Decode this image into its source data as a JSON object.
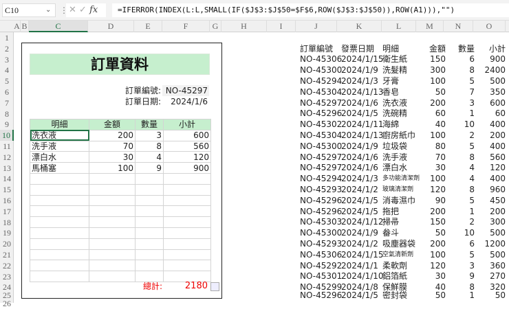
{
  "formula_bar": {
    "name_box": "C10",
    "fx": "fx",
    "formula": "=IFERROR(INDEX(L:L,SMALL(IF($J$3:$J$50=$F$6,ROW($J$3:$J$50)),ROW(A1))),\"\")"
  },
  "columns": [
    "A",
    "B",
    "C",
    "D",
    "E",
    "F",
    "G",
    "H",
    "I",
    "J",
    "K",
    "L",
    "M",
    "N",
    "O"
  ],
  "rows": [
    "1",
    "2",
    "3",
    "4",
    "5",
    "6",
    "7",
    "8",
    "9",
    "10",
    "11",
    "12",
    "13",
    "14",
    "15",
    "16",
    "17",
    "18",
    "19",
    "20",
    "21",
    "22",
    "23",
    "24",
    "25",
    "26"
  ],
  "form": {
    "title": "訂單資料",
    "order_no_label": "訂單編號:",
    "order_no": "NO-45297",
    "order_date_label": "訂單日期:",
    "order_date": "2024/1/6",
    "headers": [
      "明細",
      "金額",
      "數量",
      "小計"
    ],
    "items": [
      [
        "洗衣液",
        "200",
        "3",
        "600"
      ],
      [
        "洗手液",
        "70",
        "8",
        "560"
      ],
      [
        "漂白水",
        "30",
        "4",
        "120"
      ],
      [
        "馬桶塞",
        "100",
        "9",
        "900"
      ]
    ],
    "empty_rows": 10,
    "total_label": "總計:",
    "total": "2180"
  },
  "source": {
    "headers": [
      "訂單編號",
      "發票日期",
      "明細",
      "金額",
      "數量",
      "小計"
    ],
    "rows": [
      [
        "NO-45306",
        "2024/1/15",
        "衛生紙",
        "150",
        "6",
        "900"
      ],
      [
        "NO-45300",
        "2024/1/9",
        "洗髮精",
        "300",
        "8",
        "2400"
      ],
      [
        "NO-45294",
        "2024/1/3",
        "牙膏",
        "100",
        "5",
        "500"
      ],
      [
        "NO-45304",
        "2024/1/13",
        "香皂",
        "50",
        "7",
        "350"
      ],
      [
        "NO-45297",
        "2024/1/6",
        "洗衣液",
        "200",
        "3",
        "600"
      ],
      [
        "NO-45296",
        "2024/1/5",
        "洗碗精",
        "60",
        "1",
        "60"
      ],
      [
        "NO-45302",
        "2024/1/11",
        "海綿",
        "40",
        "10",
        "400"
      ],
      [
        "NO-45304",
        "2024/1/13",
        "廚房紙巾",
        "100",
        "2",
        "200"
      ],
      [
        "NO-45300",
        "2024/1/9",
        "垃圾袋",
        "80",
        "5",
        "400"
      ],
      [
        "NO-45297",
        "2024/1/6",
        "洗手液",
        "70",
        "8",
        "560"
      ],
      [
        "NO-45297",
        "2024/1/6",
        "漂白水",
        "30",
        "4",
        "120"
      ],
      [
        "NO-45294",
        "2024/1/3",
        "多功能清潔劑",
        "100",
        "4",
        "400"
      ],
      [
        "NO-45293",
        "2024/1/2",
        "玻璃清潔劑",
        "120",
        "8",
        "960"
      ],
      [
        "NO-45296",
        "2024/1/5",
        "消毒濕巾",
        "90",
        "5",
        "450"
      ],
      [
        "NO-45296",
        "2024/1/5",
        "拖把",
        "200",
        "1",
        "200"
      ],
      [
        "NO-45303",
        "2024/1/12",
        "掃帚",
        "150",
        "2",
        "300"
      ],
      [
        "NO-45300",
        "2024/1/9",
        "畚斗",
        "50",
        "10",
        "500"
      ],
      [
        "NO-45293",
        "2024/1/2",
        "吸塵器袋",
        "200",
        "6",
        "1200"
      ],
      [
        "NO-45306",
        "2024/1/15",
        "空氣清新劑",
        "100",
        "5",
        "500"
      ],
      [
        "NO-45292",
        "2024/1/1",
        "柔軟劑",
        "120",
        "3",
        "360"
      ],
      [
        "NO-45301",
        "2024/1/10",
        "鋁箔紙",
        "30",
        "9",
        "270"
      ],
      [
        "NO-45299",
        "2024/1/8",
        "保鮮膜",
        "40",
        "8",
        "320"
      ],
      [
        "NO-45296",
        "2024/1/5",
        "密封袋",
        "50",
        "1",
        "50"
      ]
    ]
  }
}
